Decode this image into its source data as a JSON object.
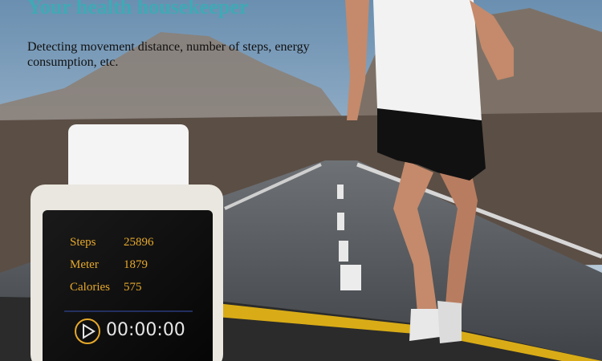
{
  "headline": "Your health housekeeper",
  "subtext": "Detecting movement distance, number of steps, energy consumption, etc.",
  "watch": {
    "rows": [
      {
        "label": "Steps",
        "value": "25896"
      },
      {
        "label": "Meter",
        "value": "1879"
      },
      {
        "label": "Calories",
        "value": "575"
      }
    ],
    "timer": "00:00:00",
    "play_icon": "play-circle-icon"
  },
  "colors": {
    "headline": "#3fa9b5",
    "screen_text": "#e6a92b",
    "road_stripe": "#d9ac17"
  }
}
